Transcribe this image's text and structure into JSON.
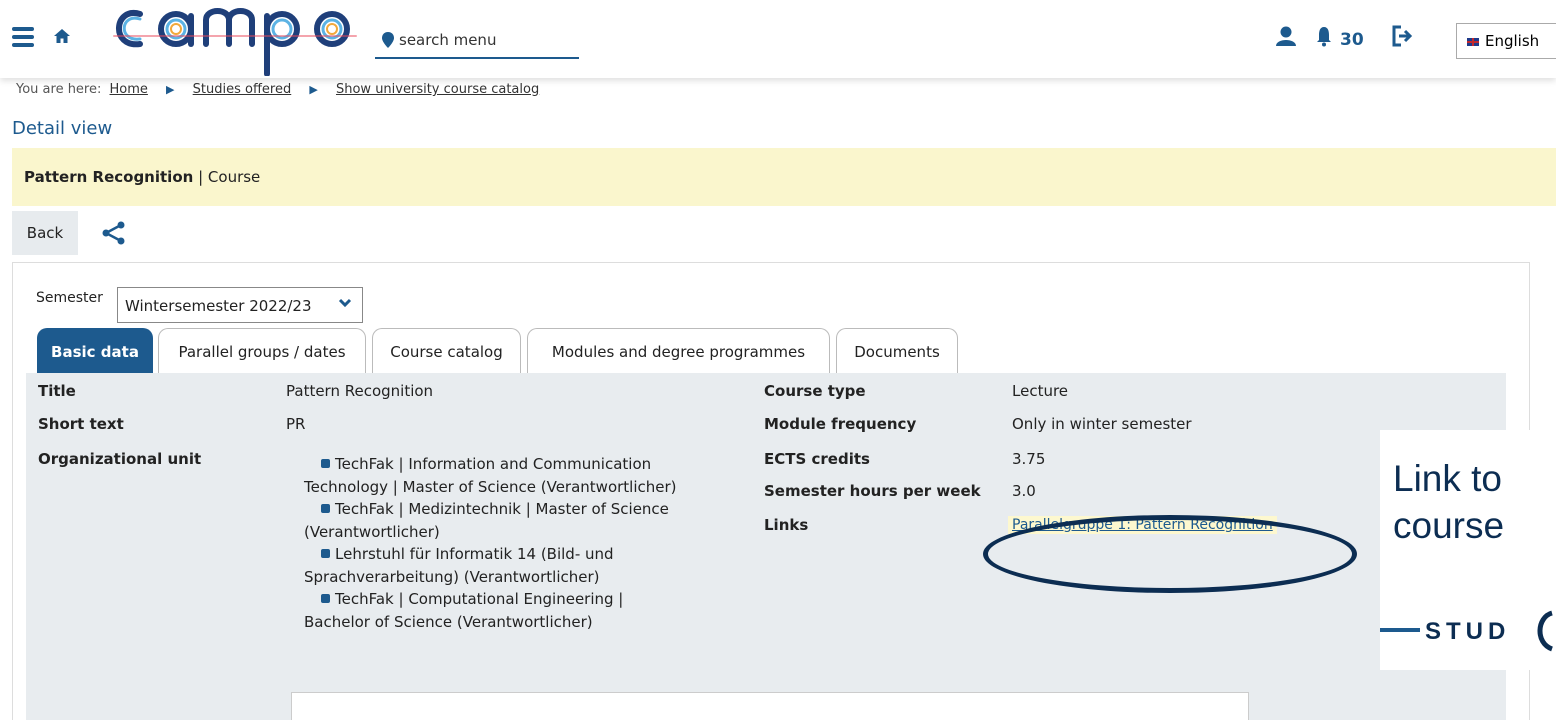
{
  "header": {
    "logo_text": "campo",
    "search_placeholder": "search menu",
    "notifications_count": "30",
    "language": "English"
  },
  "breadcrumb": {
    "prefix": "You are here:",
    "items": [
      "Home",
      "Studies offered",
      "Show university course catalog"
    ]
  },
  "page": {
    "heading": "Detail view",
    "course_title": "Pattern Recognition",
    "course_kind": "| Course",
    "back_label": "Back"
  },
  "semester": {
    "label": "Semester",
    "selected": "Wintersemester 2022/23"
  },
  "tabs": [
    {
      "label": "Basic data"
    },
    {
      "label": "Parallel groups / dates"
    },
    {
      "label": "Course catalog"
    },
    {
      "label": "Modules and degree programmes"
    },
    {
      "label": "Documents"
    }
  ],
  "basic_data": {
    "left": [
      {
        "label": "Title",
        "value": "Pattern Recognition"
      },
      {
        "label": "Short text",
        "value": "PR"
      },
      {
        "label": "Organizational unit",
        "value": ""
      }
    ],
    "org_units": [
      "TechFak | Information and Communication Technology | Master of Science (Verantwortlicher)",
      "TechFak | Medizintechnik | Master of Science (Verantwortlicher)",
      "Lehrstuhl für Informatik 14 (Bild- und Sprachverarbeitung) (Verantwortlicher)",
      "TechFak | Computational Engineering | Bachelor of Science (Verantwortlicher)"
    ],
    "right": [
      {
        "label": "Course type",
        "value": "Lecture"
      },
      {
        "label": "Module frequency",
        "value": "Only in winter semester"
      },
      {
        "label": "ECTS credits",
        "value": "3.75"
      },
      {
        "label": "Semester hours per week",
        "value": "3.0"
      },
      {
        "label": "Links",
        "value": "Parallelgruppe 1: Pattern Recognition"
      }
    ]
  },
  "overlay": {
    "line1": "Link to",
    "line2": "course",
    "brand": "STUD"
  },
  "colors": {
    "brand_blue": "#1d5a8e",
    "title_bar": "#faf6cd",
    "annotation_navy": "#0c2d52"
  }
}
